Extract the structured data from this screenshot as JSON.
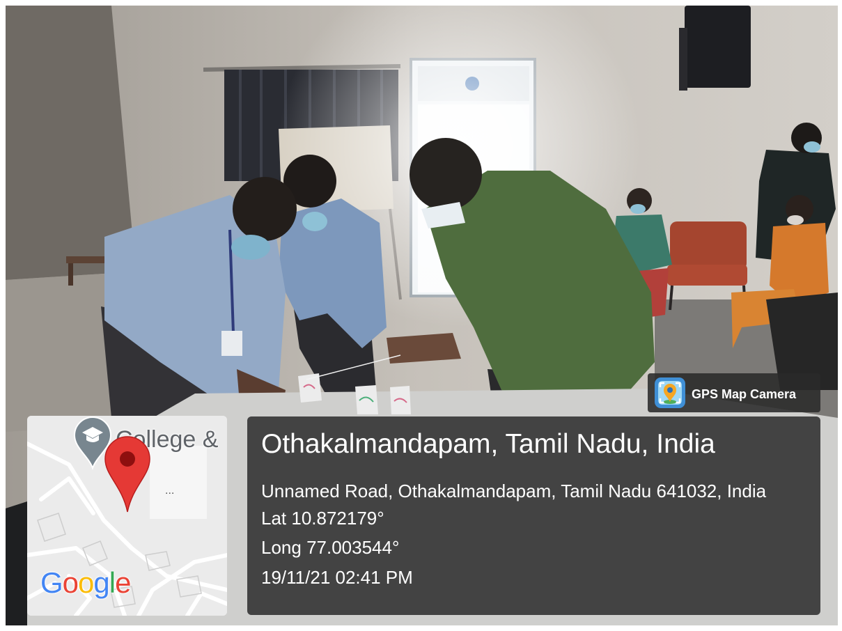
{
  "app_badge": {
    "label": "GPS Map Camera",
    "icon": "gps-map-camera-icon"
  },
  "map_thumbnail": {
    "place_label": "College &",
    "ellipsis": "...",
    "provider_logo": "Google",
    "icons": [
      "graduation-cap-pin-icon",
      "location-pin-icon"
    ],
    "logo_colors": [
      "#4285F4",
      "#EA4335",
      "#FBBC05",
      "#4285F4",
      "#34A853",
      "#EA4335"
    ]
  },
  "location_card": {
    "title": "Othakalmandapam, Tamil Nadu, India",
    "address": "Unnamed Road, Othakalmandapam, Tamil Nadu 641032, India",
    "latitude": "Lat 10.872179°",
    "longitude": "Long 77.003544°",
    "timestamp": "19/11/21 02:41 PM"
  },
  "colors": {
    "card_background": "#2a2a2a",
    "card_text": "#ffffff",
    "pin_red": "#e53935",
    "pin_grey": "#78868f",
    "map_background": "#ebebeb"
  }
}
